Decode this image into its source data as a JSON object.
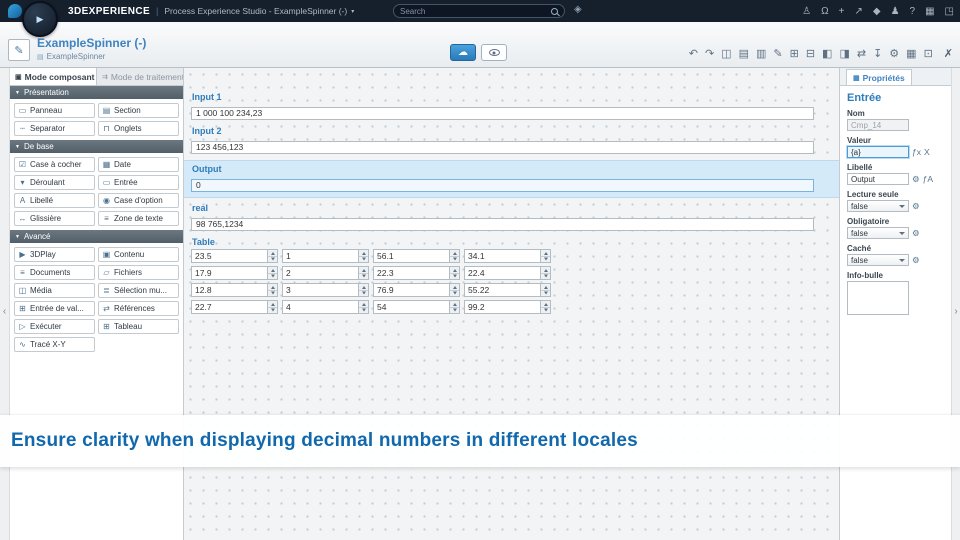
{
  "topbar": {
    "brand": "3DEXPERIENCE",
    "divider": "|",
    "app_title": "Process Experience Studio - ExampleSpinner (-)",
    "chevron": "▾",
    "search_placeholder": "Search",
    "tag_glyph": "◈",
    "icons": [
      {
        "name": "add-user",
        "glyph": "♙"
      },
      {
        "name": "notifications",
        "glyph": "Ω"
      },
      {
        "name": "add",
        "glyph": "+"
      },
      {
        "name": "share",
        "glyph": "↗"
      },
      {
        "name": "collaborate",
        "glyph": "◆"
      },
      {
        "name": "community",
        "glyph": "♟"
      },
      {
        "name": "help",
        "glyph": "?"
      },
      {
        "name": "apps",
        "glyph": "▦"
      },
      {
        "name": "fullscreen",
        "glyph": "◳"
      }
    ]
  },
  "header": {
    "title": "ExampleSpinner (-)",
    "breadcrumb": "ExampleSpinner",
    "cloud_glyph": "☁",
    "tools": [
      {
        "name": "undo",
        "glyph": "↶"
      },
      {
        "name": "redo",
        "glyph": "↷"
      },
      {
        "name": "save",
        "glyph": "◫"
      },
      {
        "name": "copy",
        "glyph": "▤"
      },
      {
        "name": "paste",
        "glyph": "▥"
      },
      {
        "name": "edit",
        "glyph": "✎"
      },
      {
        "name": "insert-row",
        "glyph": "⊞"
      },
      {
        "name": "insert-column",
        "glyph": "⊟"
      },
      {
        "name": "split-view",
        "glyph": "◧"
      },
      {
        "name": "merge-view",
        "glyph": "◨"
      },
      {
        "name": "sync",
        "glyph": "⇄"
      },
      {
        "name": "import",
        "glyph": "↧"
      },
      {
        "name": "settings",
        "glyph": "⚙"
      },
      {
        "name": "grid",
        "glyph": "▦"
      },
      {
        "name": "table",
        "glyph": "⊡"
      },
      {
        "name": "close",
        "glyph": "✗"
      }
    ]
  },
  "sidebar": {
    "tabs": [
      {
        "label": "Mode composant",
        "icon": "▣"
      },
      {
        "label": "Mode de traitement",
        "icon": "⇉"
      }
    ],
    "sections": [
      {
        "title": "Présentation",
        "items": [
          {
            "icon": "▭",
            "label": "Panneau"
          },
          {
            "icon": "▤",
            "label": "Section"
          },
          {
            "icon": "┄",
            "label": "Separator"
          },
          {
            "icon": "⊓",
            "label": "Onglets"
          }
        ]
      },
      {
        "title": "De base",
        "items": [
          {
            "icon": "☑",
            "label": "Case à cocher"
          },
          {
            "icon": "▦",
            "label": "Date"
          },
          {
            "icon": "▾",
            "label": "Déroulant"
          },
          {
            "icon": "▭",
            "label": "Entrée"
          },
          {
            "icon": "A",
            "label": "Libellé"
          },
          {
            "icon": "◉",
            "label": "Case d'option"
          },
          {
            "icon": "↔",
            "label": "Glissière"
          },
          {
            "icon": "≡",
            "label": "Zone de texte"
          }
        ]
      },
      {
        "title": "Avancé",
        "items": [
          {
            "icon": "▶",
            "label": "3DPlay"
          },
          {
            "icon": "▣",
            "label": "Contenu"
          },
          {
            "icon": "≡",
            "label": "Documents"
          },
          {
            "icon": "▱",
            "label": "Fichiers"
          },
          {
            "icon": "◫",
            "label": "Média"
          },
          {
            "icon": "≣",
            "label": "Sélection mu..."
          },
          {
            "icon": "⊞",
            "label": "Entrée de val..."
          },
          {
            "icon": "⇄",
            "label": "Références"
          },
          {
            "icon": "▷",
            "label": "Exécuter"
          },
          {
            "icon": "⊞",
            "label": "Tableau"
          },
          {
            "icon": "∿",
            "label": "Tracé X-Y"
          }
        ]
      }
    ]
  },
  "canvas": {
    "fields": [
      {
        "label": "Input 1",
        "value": "1 000 100 234,23"
      },
      {
        "label": "Input 2",
        "value": "123 456,123"
      },
      {
        "label": "Output",
        "value": "0"
      },
      {
        "label": "real",
        "value": "98 765,1234"
      }
    ],
    "table_label": "Table",
    "table": {
      "rows": [
        [
          "23.5",
          "1",
          "56.1",
          "34.1"
        ],
        [
          "17.9",
          "2",
          "22.3",
          "22.4"
        ],
        [
          "12.8",
          "3",
          "76.9",
          "55.22"
        ],
        [
          "22.7",
          "4",
          "54",
          "99.2"
        ]
      ]
    }
  },
  "properties": {
    "tab_label": "Propriétés",
    "title": "Entrée",
    "fields": [
      {
        "label": "Nom",
        "value": "Cmp_14"
      },
      {
        "label": "Valeur",
        "value": "{a}"
      },
      {
        "label": "Libellé",
        "value": "Output"
      },
      {
        "label": "Lecture seule",
        "value": "false"
      },
      {
        "label": "Obligatoire",
        "value": "false"
      },
      {
        "label": "Caché",
        "value": "false"
      },
      {
        "label": "Info-bulle",
        "value": ""
      }
    ],
    "valeur_icons": [
      {
        "name": "formula",
        "glyph": "ƒx"
      },
      {
        "name": "parameter",
        "glyph": "X"
      }
    ],
    "libelle_icons": [
      {
        "name": "settings",
        "glyph": "⚙"
      },
      {
        "name": "translate",
        "glyph": "ƒA"
      }
    ]
  },
  "caption": {
    "text": "Ensure clarity when displaying decimal numbers in different locales"
  },
  "icons": {
    "gear": "⚙",
    "play": "▶",
    "section_caret": "▼",
    "breadcrumb_doc": "▤",
    "props_tab": "▦",
    "app": "✎",
    "chevron_left": "‹",
    "chevron_right": "›"
  },
  "colors": {
    "accent": "#2f7cba",
    "topbar": "#161f2c",
    "selection": "#d5eaf8"
  }
}
